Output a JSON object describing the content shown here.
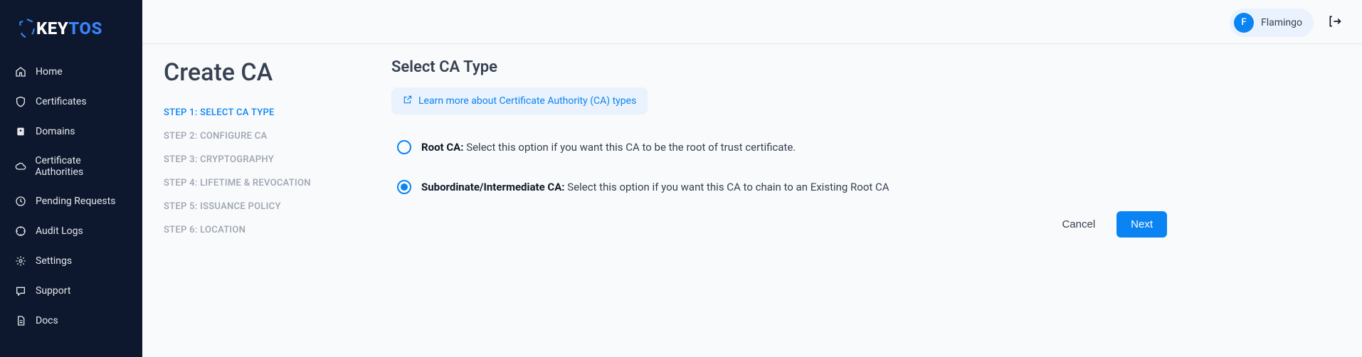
{
  "brand": {
    "part1": "KEY",
    "part2": "TOS"
  },
  "nav": {
    "home": "Home",
    "certificates": "Certificates",
    "domains": "Domains",
    "certificate_authorities": "Certificate Authorities",
    "pending_requests": "Pending Requests",
    "audit_logs": "Audit Logs",
    "settings": "Settings",
    "support": "Support",
    "docs": "Docs"
  },
  "user": {
    "initial": "F",
    "name": "Flamingo"
  },
  "page": {
    "title": "Create CA"
  },
  "steps": {
    "s1": "STEP 1: SELECT CA TYPE",
    "s2": "STEP 2: CONFIGURE CA",
    "s3": "STEP 3: CRYPTOGRAPHY",
    "s4": "STEP 4: LIFETIME & REVOCATION",
    "s5": "STEP 5: ISSUANCE POLICY",
    "s6": "STEP 6: LOCATION"
  },
  "section": {
    "title": "Select CA Type",
    "learn_more": "Learn more about Certificate Authority (CA) types"
  },
  "options": {
    "root": {
      "title": "Root CA:",
      "desc": " Select this option if you want this CA to be the root of trust certificate.",
      "selected": false
    },
    "sub": {
      "title": "Subordinate/Intermediate CA:",
      "desc": " Select this option if you want this CA to chain to an Existing Root CA",
      "selected": true
    }
  },
  "actions": {
    "cancel": "Cancel",
    "next": "Next"
  }
}
